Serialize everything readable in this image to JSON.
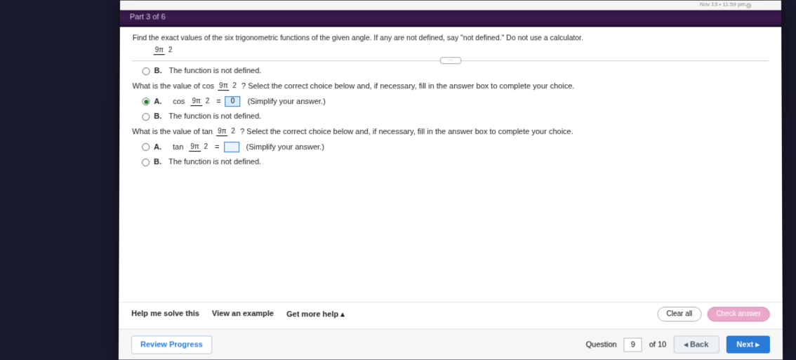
{
  "system_time": "Nov 13 • 11:59 pm",
  "header": {
    "part_label": "Part 3 of 6"
  },
  "instructions": "Find the exact values of the six trigonometric functions of the given angle. If any are not defined, say \"not defined.\"  Do not use a calculator.",
  "angle": {
    "numerator": "9π",
    "denominator": "2"
  },
  "q_prev": {
    "option_b": "The function is not defined."
  },
  "q_cos": {
    "prompt_pre": "What is the value of cos ",
    "prompt_post": "? Select the correct choice below and, if necessary, fill in the answer box to complete your choice.",
    "optA_letter": "A.",
    "optA_prefix": "cos ",
    "optA_equals": " = ",
    "optA_value": "0",
    "optA_hint": "(Simplify your answer.)",
    "optB_letter": "B.",
    "optB_text": "The function is not defined."
  },
  "q_tan": {
    "prompt_pre": "What is the value of tan ",
    "prompt_post": "? Select the correct choice below and, if necessary, fill in the answer box to complete your choice.",
    "optA_letter": "A.",
    "optA_prefix": "tan ",
    "optA_equals": " = ",
    "optA_value": "",
    "optA_hint": "(Simplify your answer.)",
    "optB_letter": "B.",
    "optB_text": "The function is not defined."
  },
  "actions": {
    "clear": "Clear all",
    "check": "Check answer",
    "help_solve": "Help me solve this",
    "view_example": "View an example",
    "get_help": "Get more help ▴"
  },
  "nav": {
    "review": "Review Progress",
    "question_label": "Question",
    "question_num": "9",
    "of": "of 10",
    "back": "◂ Back",
    "next": "Next ▸"
  }
}
